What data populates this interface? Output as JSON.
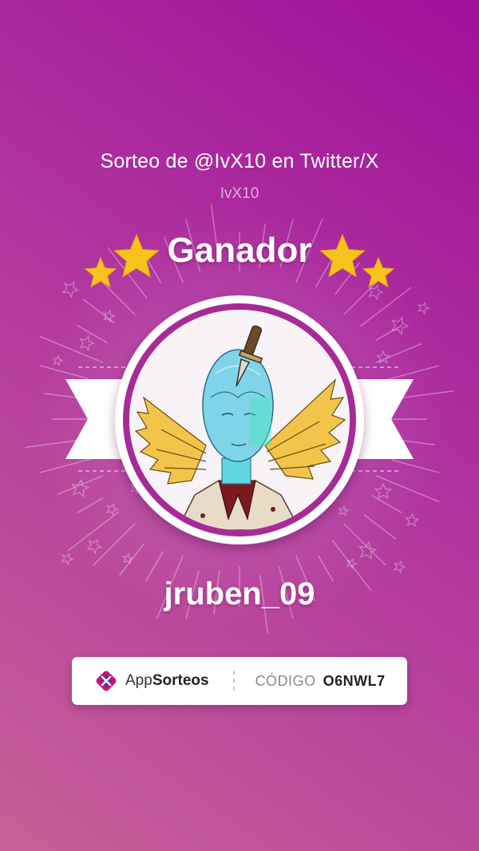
{
  "raffle": {
    "title": "Sorteo de @IvX10 en Twitter/X",
    "account": "IvX10"
  },
  "result": {
    "heading": "Ganador",
    "winner_username": "jruben_09"
  },
  "footer": {
    "brand_prefix": "App",
    "brand_suffix": "Sorteos",
    "code_label": "CÓDIGO",
    "code_value": "O6NWL7"
  },
  "icons": {
    "stars": "star-icon",
    "avatar": "winner-avatar",
    "brand": "appsorteos-logo-icon"
  },
  "colors": {
    "background_top": "#a0109a",
    "background_bottom": "#c86098",
    "star": "#f6c21c",
    "ribbon": "#ffffff",
    "ring": "#a62b96"
  }
}
